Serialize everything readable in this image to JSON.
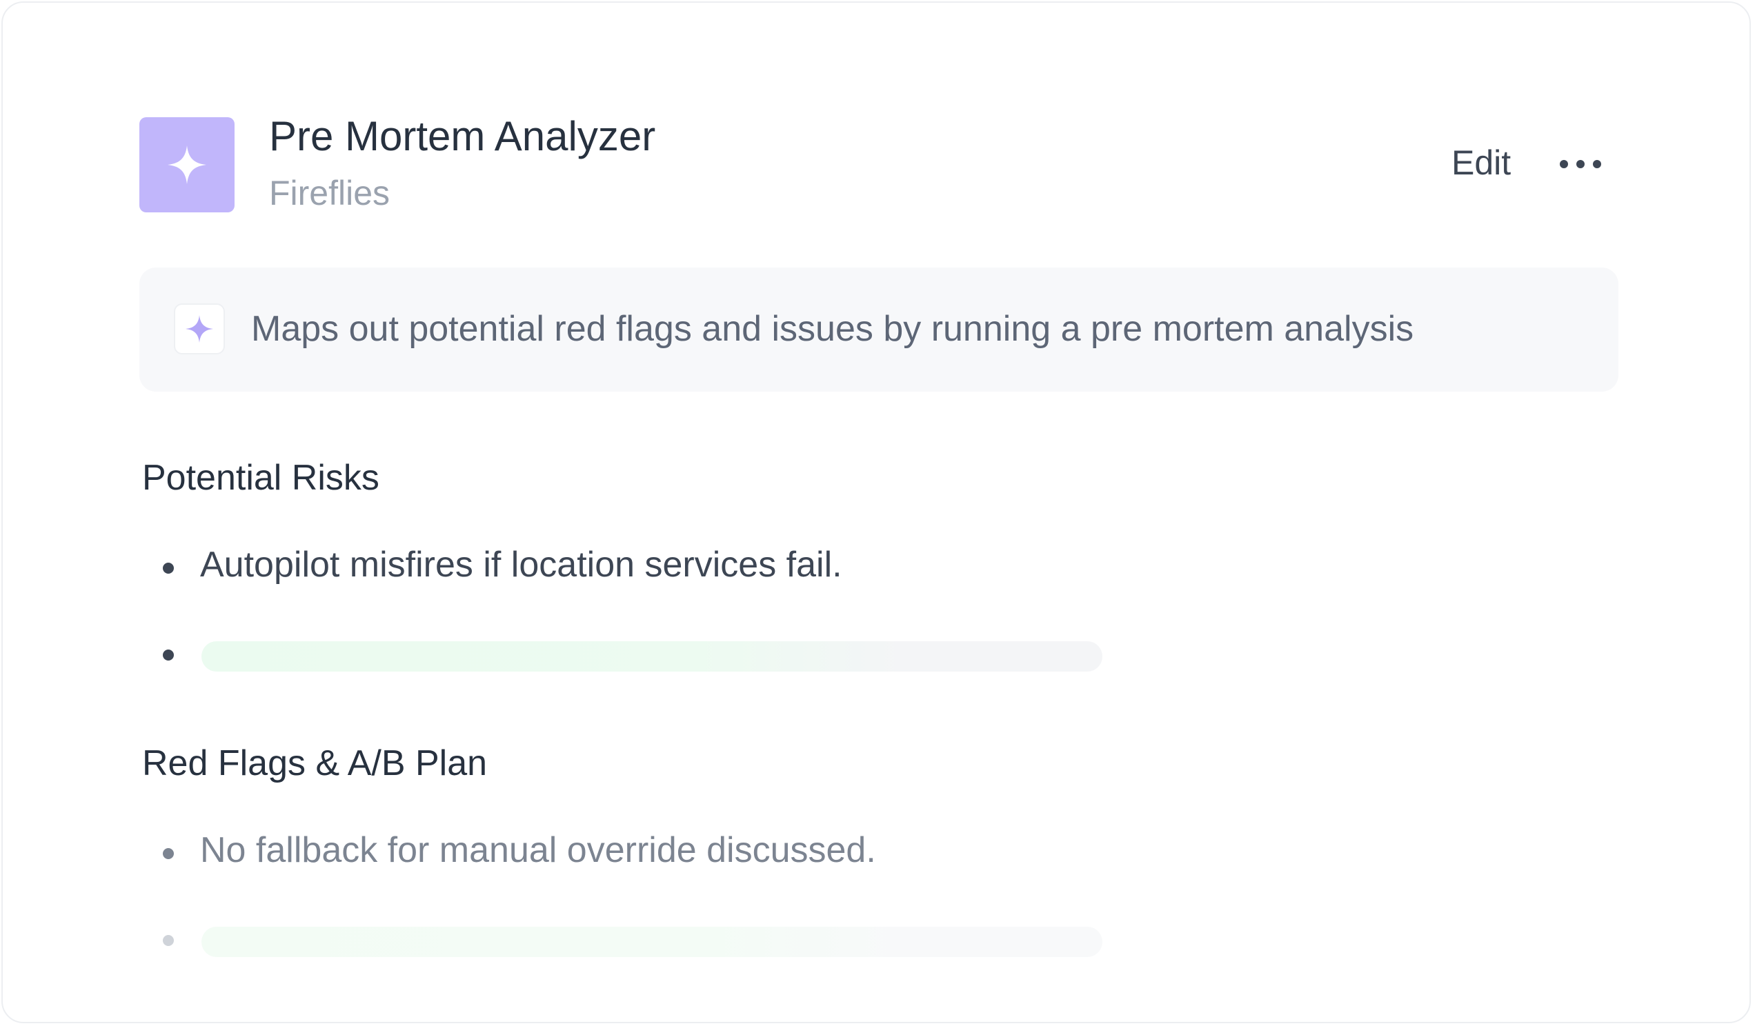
{
  "header": {
    "title": "Pre Mortem Analyzer",
    "subtitle": "Fireflies",
    "app_icon": "sparkle-icon",
    "edit_label": "Edit",
    "more_icon": "more-horizontal-icon"
  },
  "description": {
    "icon": "sparkle-icon",
    "text": "Maps out potential red flags and issues by running a pre mortem analysis"
  },
  "sections": [
    {
      "title": "Potential Risks",
      "items": [
        {
          "text": "Autopilot misfires if location services fail."
        }
      ],
      "loading_items": 1
    },
    {
      "title": "Red Flags & A/B Plan",
      "items": [
        {
          "text": "No fallback for manual override discussed."
        }
      ],
      "loading_items": 1
    }
  ],
  "colors": {
    "accent": "#c1b6fb",
    "accent_light": "#b3a6f7",
    "title_text": "#27313f",
    "muted_text": "#9aa2ae",
    "body_text": "#3d4654",
    "faded_text": "#7c8491",
    "panel_bg": "#f7f8fa",
    "skeleton_green": "#ebfbf0",
    "skeleton_gray": "#f4f5f7"
  }
}
